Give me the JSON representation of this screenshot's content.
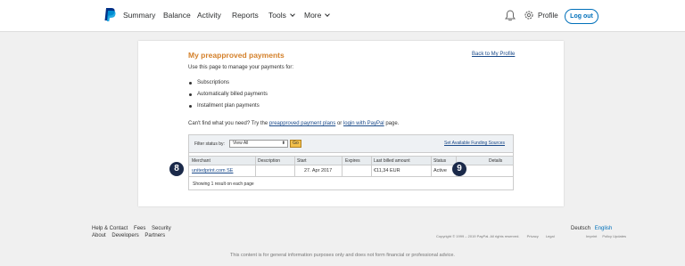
{
  "nav": {
    "items": [
      "Summary",
      "Balance",
      "Activity",
      "Reports",
      "Tools",
      "More"
    ],
    "profile": "Profile",
    "logout": "Log out"
  },
  "page": {
    "title": "My preapproved payments",
    "back_link": "Back to My Profile",
    "intro": "Use this page to manage your payments for:",
    "bullets": [
      "Subscriptions",
      "Automatically billed payments",
      "Installment plan payments"
    ],
    "cant_find_prefix": "Can't find what you need? Try the",
    "preapproved_link": "preapproved payment plans",
    "or": "or",
    "login_link": "login with PayPal",
    "page_suffix": "page."
  },
  "filter": {
    "label": "Filter status by:",
    "selected": "View All",
    "go": "Go",
    "funding_link": "Set Available Funding Sources"
  },
  "table": {
    "headers": [
      "Merchant",
      "Description",
      "Start",
      "Expires",
      "Last billed amount",
      "Status",
      "Details"
    ],
    "rows": [
      {
        "merchant": "unitedprint.com SE",
        "description": "",
        "start": "27. Apr 2017",
        "expires": "",
        "last_billed": "€11,34 EUR",
        "status": "Active",
        "details": ""
      }
    ],
    "showing": "Showing 1 result on each page"
  },
  "markers": [
    "8",
    "9"
  ],
  "footer": {
    "row1": [
      "Help & Contact",
      "Fees",
      "Security"
    ],
    "row2": [
      "About",
      "Developers",
      "Partners"
    ],
    "lang_de": "Deutsch",
    "lang_en": "English",
    "copyright": "Copyright © 1999 – 2019 PayPal. All rights reserved.",
    "privacy": "Privacy",
    "legal": "Legal",
    "imprint": "Imprint",
    "policy_updates": "Policy Updates",
    "disclaimer": "This content is for general information purposes only and does not form financial or professional advice."
  },
  "colors": {
    "brand": "#0070ba",
    "title": "#d4802a",
    "marker": "#1b2a4a"
  }
}
